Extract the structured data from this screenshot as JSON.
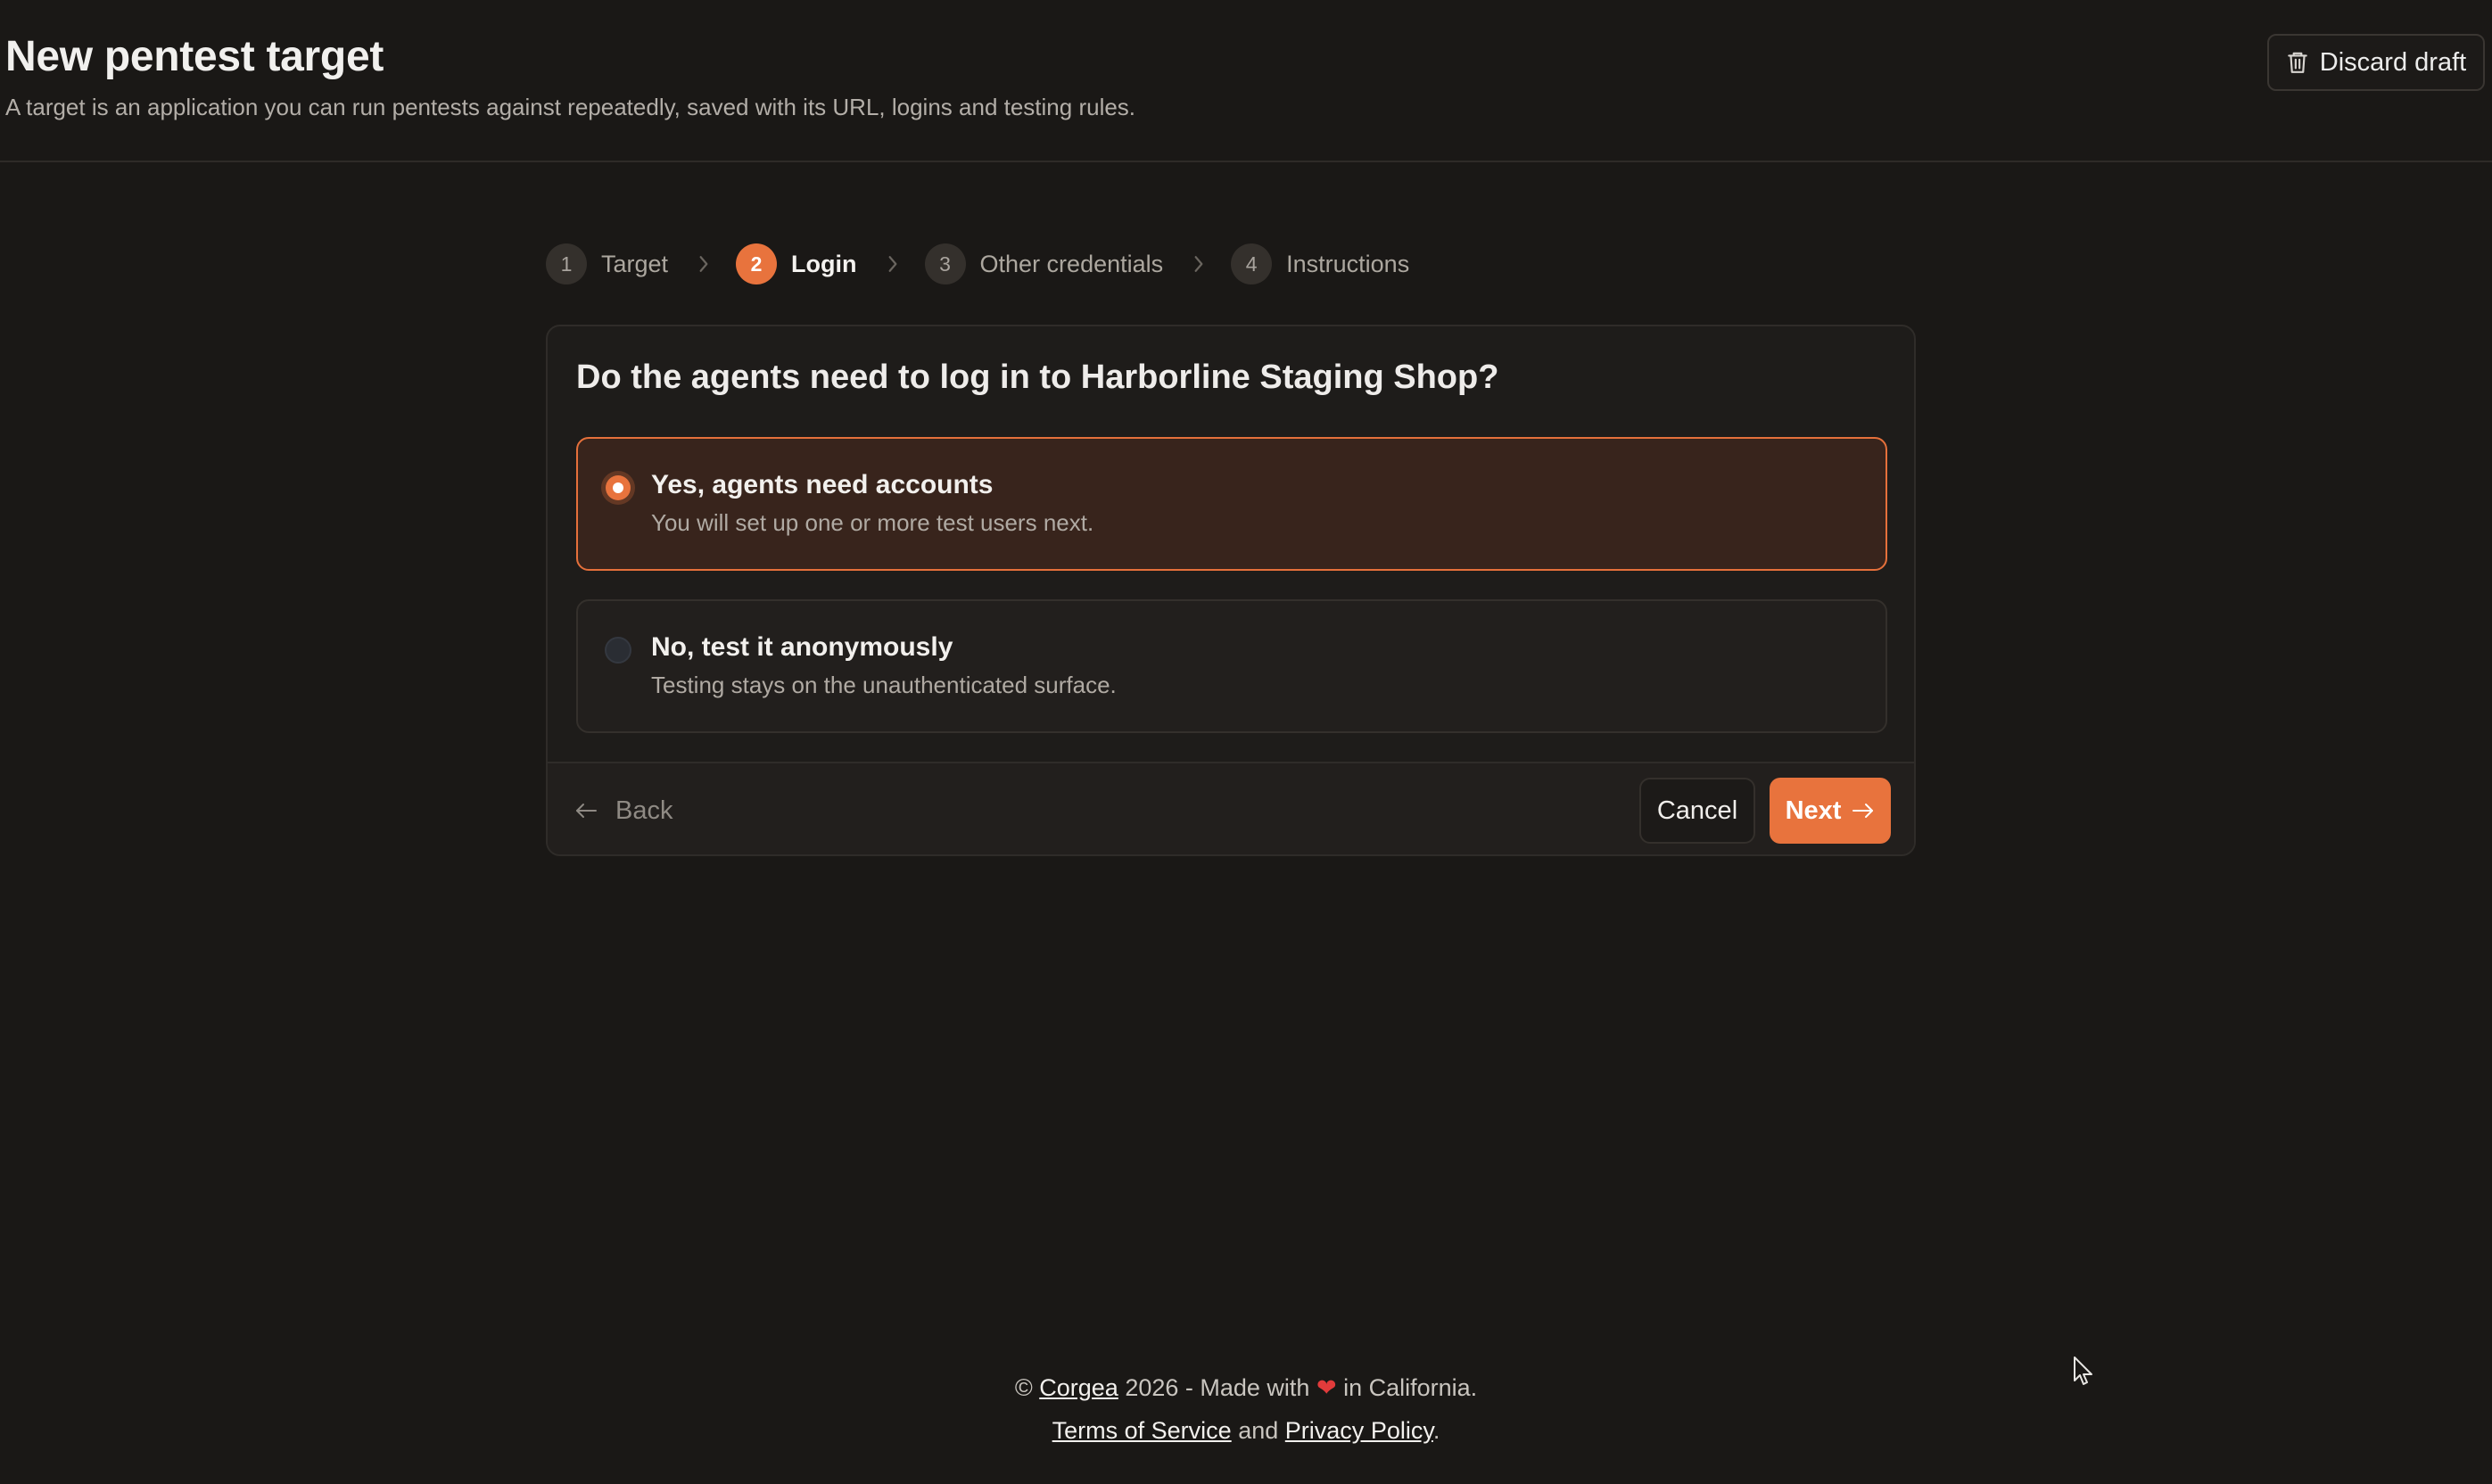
{
  "header": {
    "title": "New pentest target",
    "subtitle": "A target is an application you can run pentests against repeatedly, saved with its URL, logins and testing rules.",
    "discard_label": "Discard draft"
  },
  "stepper": {
    "steps": [
      {
        "number": "1",
        "label": "Target",
        "active": false
      },
      {
        "number": "2",
        "label": "Login",
        "active": true
      },
      {
        "number": "3",
        "label": "Other credentials",
        "active": false
      },
      {
        "number": "4",
        "label": "Instructions",
        "active": false
      }
    ]
  },
  "card": {
    "question": "Do the agents need to log in to Harborline Staging Shop?",
    "options": [
      {
        "title": "Yes, agents need accounts",
        "description": "You will set up one or more test users next.",
        "selected": true
      },
      {
        "title": "No, test it anonymously",
        "description": "Testing stays on the unauthenticated surface.",
        "selected": false
      }
    ],
    "back_label": "Back",
    "cancel_label": "Cancel",
    "next_label": "Next"
  },
  "footer": {
    "copyright": "©",
    "company": "Corgea",
    "made_with_prefix": "2026 - Made with",
    "heart": "❤",
    "made_with_suffix": "in California.",
    "terms": "Terms of Service",
    "and": "and",
    "privacy": "Privacy Policy",
    "period": "."
  },
  "colors": {
    "accent": "#e8733d",
    "background": "#1a1816",
    "card": "#1e1c1a",
    "selected_option_bg": "#38241c"
  }
}
